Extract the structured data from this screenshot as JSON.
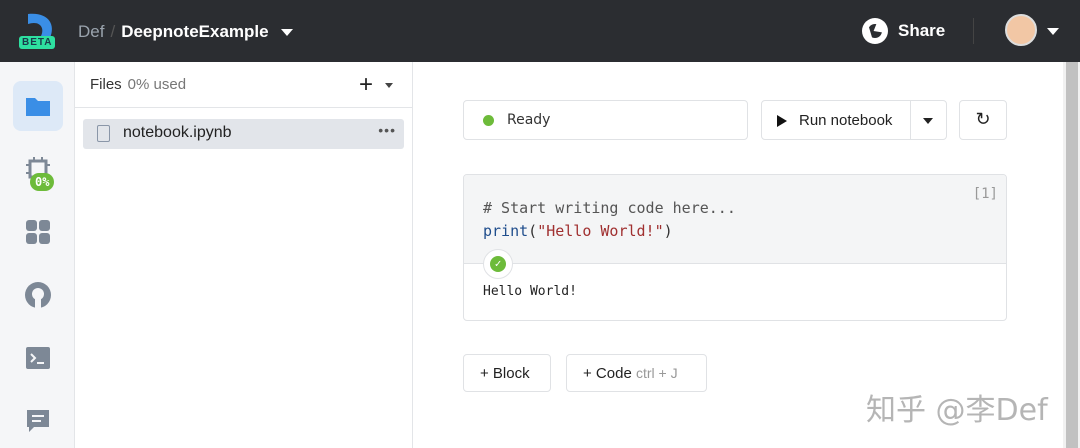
{
  "header": {
    "beta_label": "BETA",
    "workspace": "Def",
    "separator": "/",
    "project": "DeepnoteExample",
    "share_label": "Share"
  },
  "files": {
    "title": "Files",
    "usage": "0% used",
    "add_label": "+",
    "items": [
      {
        "name": "notebook.ipynb",
        "more": "•••"
      }
    ]
  },
  "sidebar": {
    "cpu_badge": "0%"
  },
  "toolbar": {
    "status": "Ready",
    "status_color": "#6dbb3a",
    "run_label": "Run notebook",
    "refresh_icon": "↻"
  },
  "cell": {
    "exec_count": "[1]",
    "comment": "# Start writing code here...",
    "kw": "print",
    "open": "(",
    "str": "\"Hello World!\"",
    "close": ")",
    "output": "Hello World!"
  },
  "add": {
    "block_label": "+ Block",
    "code_label": "+ Code",
    "code_hint": "ctrl + J"
  },
  "watermark": "知乎 @李Def"
}
